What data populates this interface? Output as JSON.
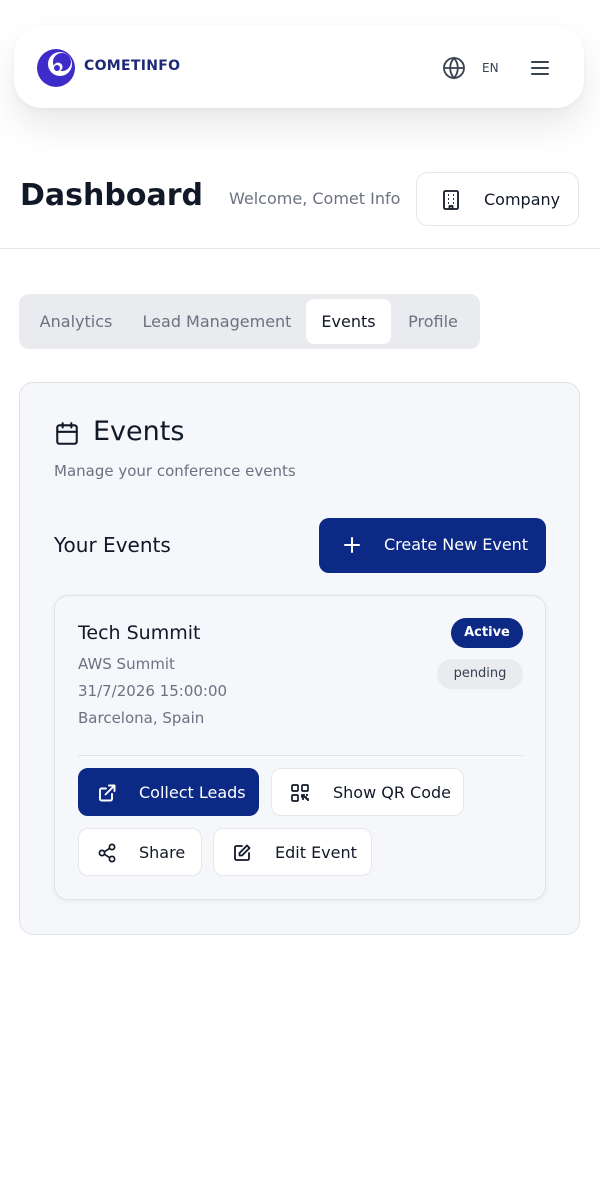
{
  "header": {
    "brand": "COMETINFO",
    "language": "EN",
    "icons": {
      "logo": "comet-logo-icon",
      "globe": "globe-icon",
      "menu": "hamburger-menu-icon"
    }
  },
  "page": {
    "title": "Dashboard",
    "welcome": "Welcome, Comet Info",
    "company_button": "Company"
  },
  "tabs": [
    {
      "label": "Analytics",
      "active": false
    },
    {
      "label": "Lead Management",
      "active": false
    },
    {
      "label": "Events",
      "active": true
    },
    {
      "label": "Profile",
      "active": false
    }
  ],
  "events_card": {
    "title": "Events",
    "subtitle": "Manage your conference events",
    "section_heading": "Your Events",
    "create_button": "Create New Event",
    "events": [
      {
        "name": "Tech Summit",
        "conference": "AWS Summit",
        "datetime": "31/7/2026 15:00:00",
        "location": "Barcelona, Spain",
        "status_badge": "Active",
        "approval_badge": "pending",
        "actions": {
          "collect_leads": "Collect Leads",
          "show_qr": "Show QR Code",
          "share": "Share",
          "edit": "Edit Event"
        }
      }
    ]
  },
  "colors": {
    "primary": "#0b2985",
    "brand_text": "#1e2a78",
    "logo_purple": "#3d2cc7",
    "muted_text": "#6b7280",
    "card_bg": "#f5f7fa"
  }
}
